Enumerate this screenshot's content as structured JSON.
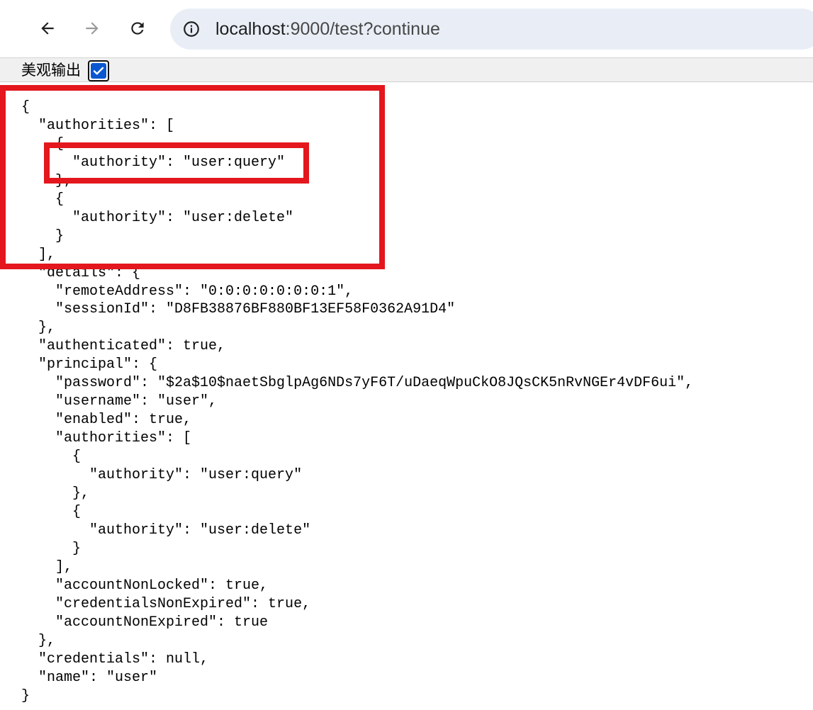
{
  "browser": {
    "url_host": "localhost",
    "url_path": ":9000/test?continue",
    "icons": {
      "back": "arrow-left-icon",
      "forward": "arrow-right-icon",
      "reload": "reload-icon",
      "site_info": "info-circle-icon",
      "checkbox": "check-icon"
    },
    "accent_color": "#0b57d0"
  },
  "options": {
    "pretty_print_label": "美观输出",
    "pretty_print_checked": true
  },
  "json_lines": [
    "{",
    "  \"authorities\": [",
    "    {",
    "      \"authority\": \"user:query\"",
    "    },",
    "    {",
    "      \"authority\": \"user:delete\"",
    "    }",
    "  ],",
    "  \"details\": {",
    "    \"remoteAddress\": \"0:0:0:0:0:0:0:1\",",
    "    \"sessionId\": \"D8FB38876BF880BF13EF58F0362A91D4\"",
    "  },",
    "  \"authenticated\": true,",
    "  \"principal\": {",
    "    \"password\": \"$2a$10$naetSbglpAg6NDs7yF6T/uDaeqWpuCkO8JQsCK5nRvNGEr4vDF6ui\",",
    "    \"username\": \"user\",",
    "    \"enabled\": true,",
    "    \"authorities\": [",
    "      {",
    "        \"authority\": \"user:query\"",
    "      },",
    "      {",
    "        \"authority\": \"user:delete\"",
    "      }",
    "    ],",
    "    \"accountNonLocked\": true,",
    "    \"credentialsNonExpired\": true,",
    "    \"accountNonExpired\": true",
    "  },",
    "  \"credentials\": null,",
    "  \"name\": \"user\"",
    "}"
  ],
  "annotation_color": "#e3171d"
}
